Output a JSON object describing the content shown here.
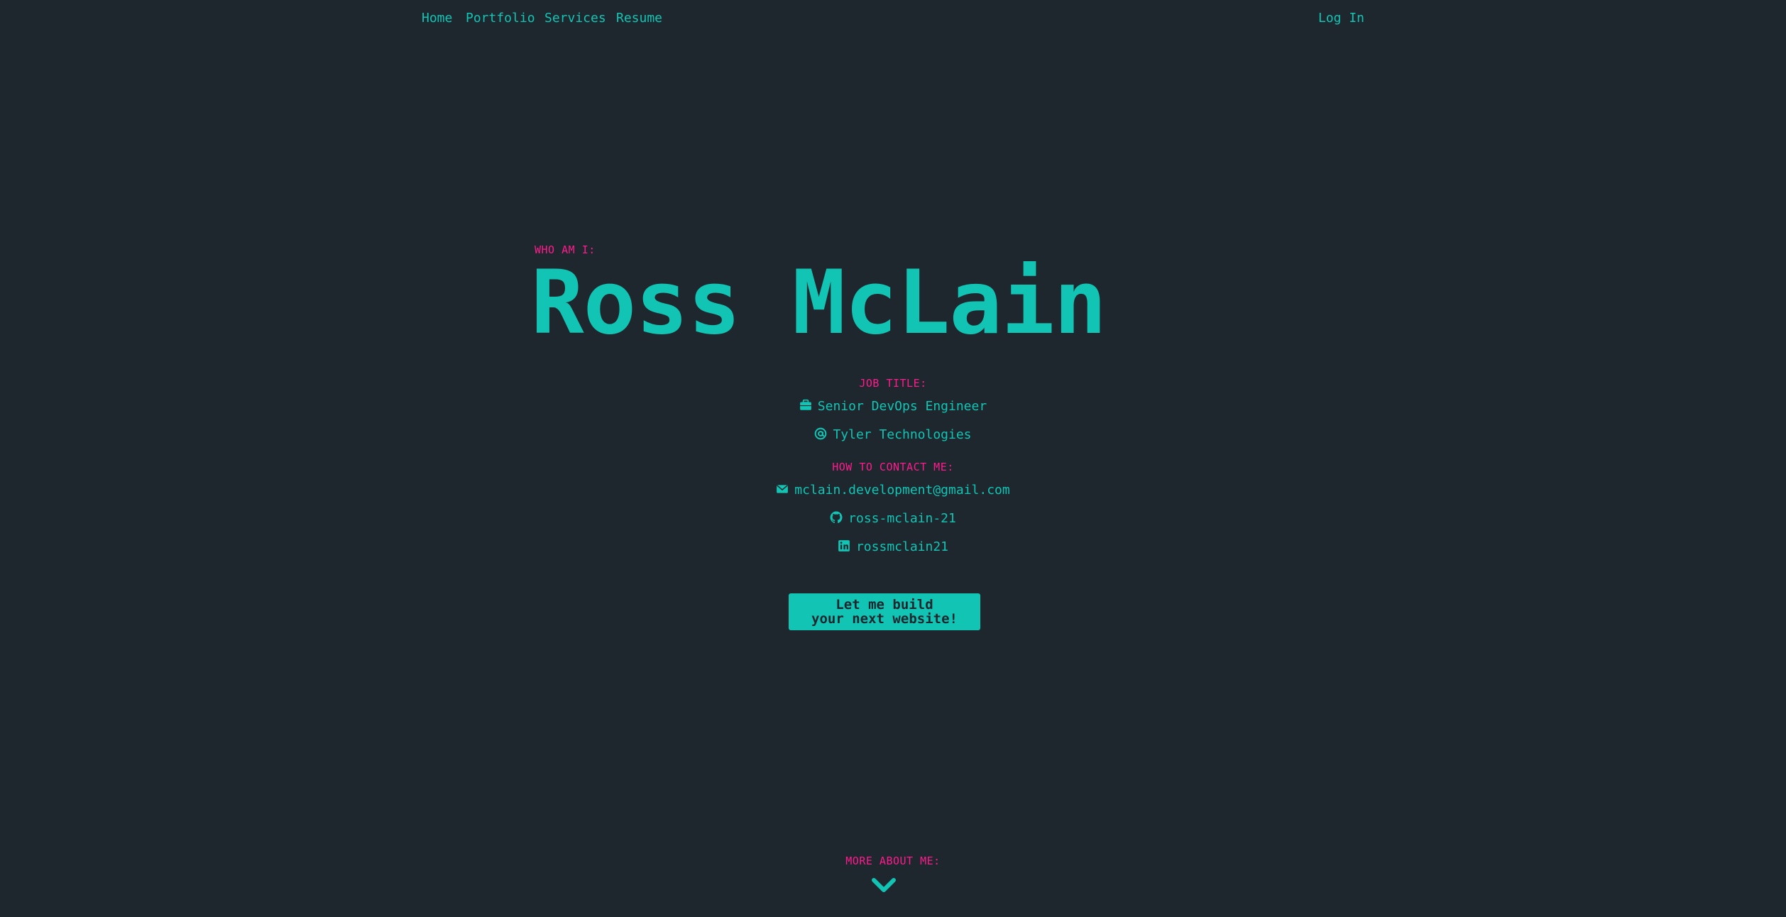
{
  "nav": {
    "items": [
      {
        "label": "Home"
      },
      {
        "label": "Portfolio"
      },
      {
        "label": "Services"
      },
      {
        "label": "Resume"
      }
    ],
    "login_label": "Log In"
  },
  "hero": {
    "who_label": "WHO AM I:",
    "name": "Ross McLain"
  },
  "job": {
    "label": "JOB TITLE:",
    "title": "Senior DevOps Engineer",
    "company": "Tyler Technologies"
  },
  "contact": {
    "label": "HOW TO CONTACT ME:",
    "email": "mclain.development@gmail.com",
    "github": "ross-mclain-21",
    "linkedin": "rossmclain21"
  },
  "cta": {
    "line1": "Let me build",
    "line2": "your next website!"
  },
  "more": {
    "label": "MORE ABOUT ME:"
  },
  "colors": {
    "background": "#1f272e",
    "accent": "#12c4b4",
    "label": "#ff1b8d"
  },
  "icons": {
    "job": "briefcase-icon",
    "company": "at-sign-icon",
    "email": "envelope-icon",
    "github": "github-icon",
    "linkedin": "linkedin-icon",
    "more": "chevron-down-icon"
  }
}
